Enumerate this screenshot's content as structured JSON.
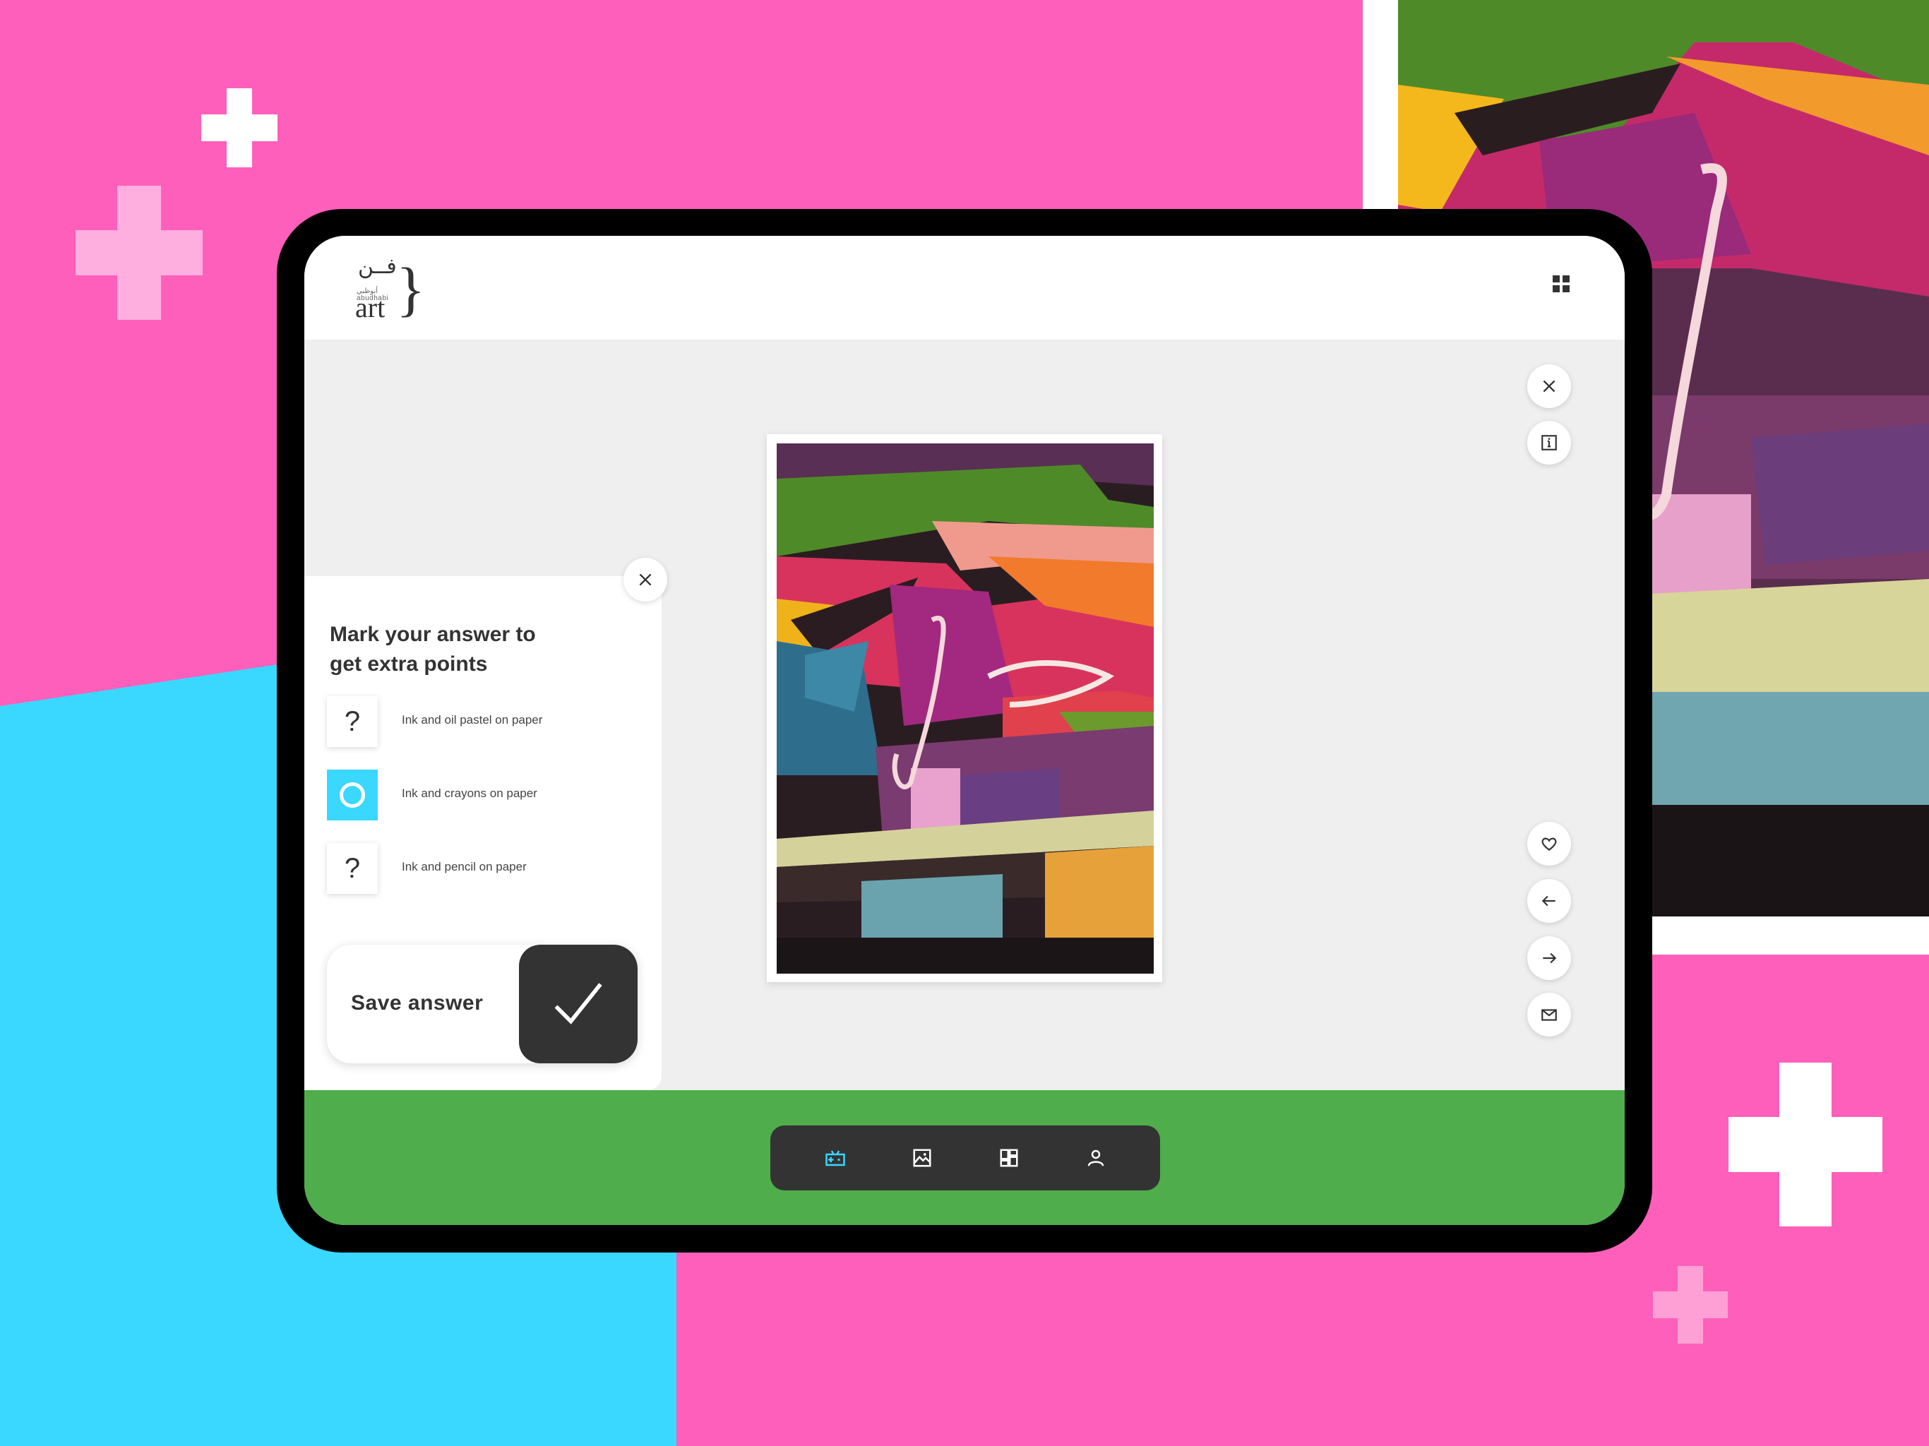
{
  "app": {
    "logo": {
      "arabic": "فــن",
      "subtitle_arabic": "أبوظبي",
      "subtitle_latin": "abudhabi",
      "wordmark": "art"
    }
  },
  "header": {
    "menu_icon": "grid-icon"
  },
  "actions_top": [
    {
      "icon": "close-icon"
    },
    {
      "icon": "info-icon"
    }
  ],
  "actions_bottom": [
    {
      "icon": "heart-icon"
    },
    {
      "icon": "arrow-left-icon"
    },
    {
      "icon": "arrow-right-icon"
    },
    {
      "icon": "mail-icon"
    }
  ],
  "quiz": {
    "title": "Mark your answer to get extra points",
    "options": [
      {
        "label": "Ink and oil pastel on paper",
        "mark": "?",
        "selected": false
      },
      {
        "label": "Ink and crayons on paper",
        "mark": "",
        "selected": true
      },
      {
        "label": "Ink and pencil on paper",
        "mark": "?",
        "selected": false
      }
    ],
    "save_label": "Save answer"
  },
  "nav": [
    {
      "icon": "game-icon",
      "active": true
    },
    {
      "icon": "image-icon",
      "active": false
    },
    {
      "icon": "dashboard-icon",
      "active": false
    },
    {
      "icon": "user-icon",
      "active": false
    }
  ],
  "colors": {
    "pink": "#fe5fbb",
    "blue": "#3ad7fe",
    "green": "#4fae4b",
    "dark": "#333333",
    "accent": "#3ad7fe"
  }
}
